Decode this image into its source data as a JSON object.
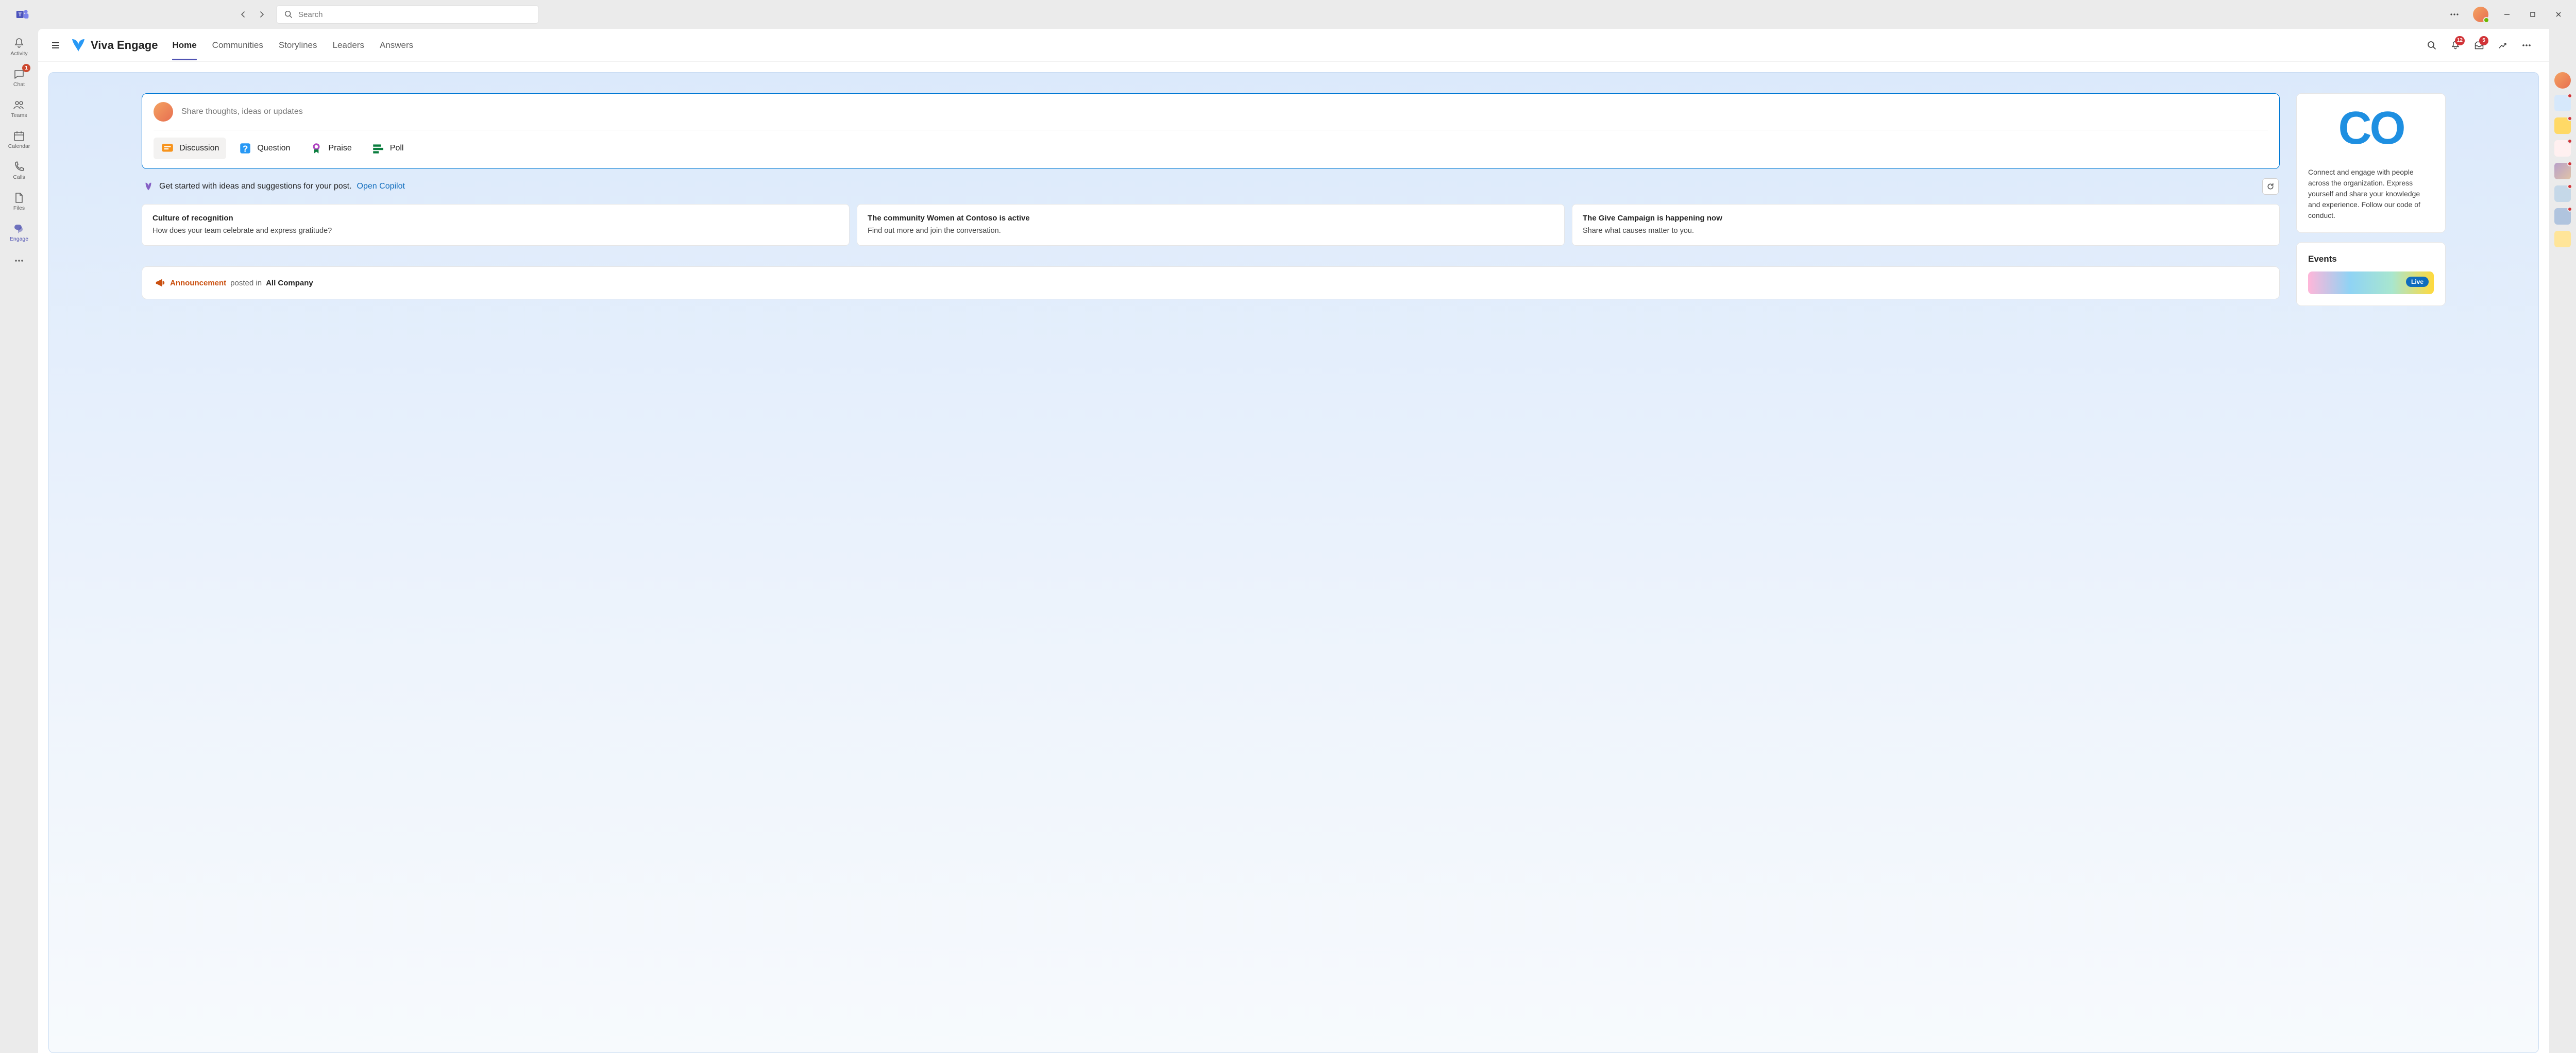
{
  "titlebar": {
    "search_placeholder": "Search"
  },
  "rail": {
    "items": [
      {
        "label": "Activity",
        "badge": null
      },
      {
        "label": "Chat",
        "badge": "1"
      },
      {
        "label": "Teams",
        "badge": null
      },
      {
        "label": "Calendar",
        "badge": null
      },
      {
        "label": "Calls",
        "badge": null
      },
      {
        "label": "Files",
        "badge": null
      },
      {
        "label": "Engage",
        "badge": null
      }
    ]
  },
  "engage": {
    "brand": "Viva Engage",
    "tabs": [
      "Home",
      "Communities",
      "Storylines",
      "Leaders",
      "Answers"
    ],
    "badges": {
      "notifications": "12",
      "inbox": "5"
    },
    "composer": {
      "placeholder": "Share thoughts, ideas or updates",
      "types": [
        "Discussion",
        "Question",
        "Praise",
        "Poll"
      ]
    },
    "copilot": {
      "text": "Get started with ideas and suggestions for your post.",
      "link": "Open Copilot"
    },
    "suggestions": [
      {
        "title": "Culture of recognition",
        "body": "How does your team celebrate and express gratitude?"
      },
      {
        "title": "The community Women at Contoso is active",
        "body": "Find out more and join the conversation."
      },
      {
        "title": "The Give Campaign is happening now",
        "body": "Share what causes matter to you."
      }
    ],
    "feed": {
      "announcement_label": "Announcement",
      "posted_in": "posted in",
      "community": "All Company"
    },
    "about": {
      "text": "Connect and engage with people across the organization. Express yourself and share your knowledge and experience. Follow our code of conduct."
    },
    "events": {
      "title": "Events",
      "live_label": "Live"
    }
  }
}
